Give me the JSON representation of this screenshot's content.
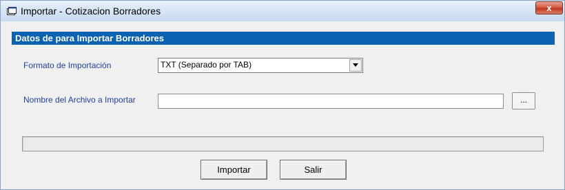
{
  "window": {
    "title": "Importar - Cotizacion Borradores",
    "close_label": "x"
  },
  "section": {
    "header": "Datos de para  Importar Borradores"
  },
  "form": {
    "format_label": "Formato de Importación",
    "format_value": "TXT (Separado por TAB)",
    "file_label": "Nombre del Archivo a Importar",
    "file_value": "",
    "browse_label": "..."
  },
  "progress": {
    "value": 0
  },
  "buttons": {
    "import_label": "Importar",
    "exit_label": "Salir"
  },
  "icons": {
    "app": "window-app-icon",
    "close": "close-icon",
    "dropdown": "chevron-down-icon"
  },
  "colors": {
    "section_header": "#0a62b0",
    "label_text": "#1f3f9f",
    "close_button": "#c0391f"
  }
}
